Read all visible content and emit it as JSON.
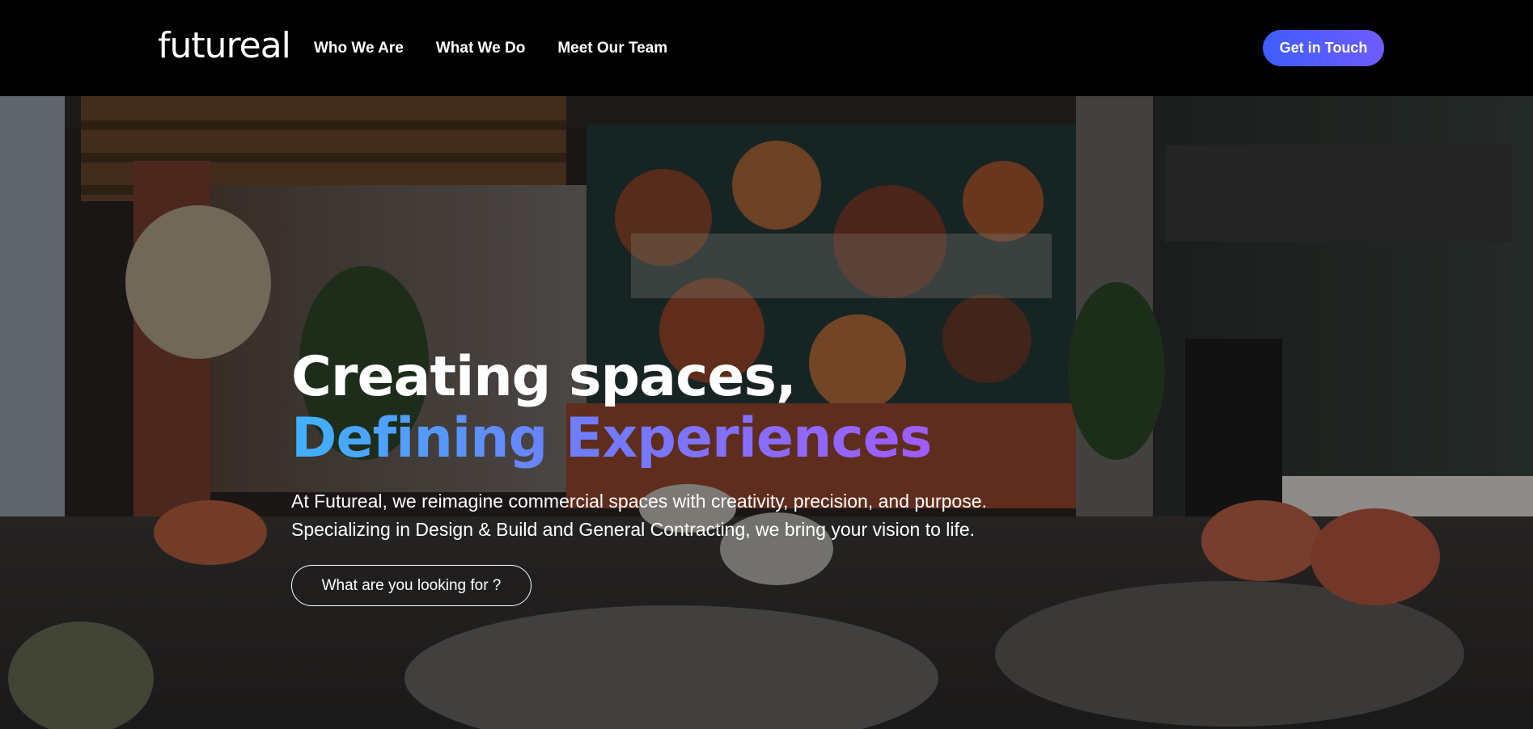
{
  "header": {
    "logo_text": "futureal",
    "nav": [
      {
        "label": "Who We Are"
      },
      {
        "label": "What We Do"
      },
      {
        "label": "Meet Our Team"
      }
    ],
    "cta_label": "Get in Touch"
  },
  "hero": {
    "headline_line1": "Creating spaces,",
    "headline_line2": "Defining Experiences",
    "subtext_line1": "At Futureal, we reimagine commercial spaces with creativity, precision, and purpose.",
    "subtext_line2": "Specializing in Design & Build and General Contracting, we bring your vision to life.",
    "button_label": "What are you looking for ?"
  },
  "colors": {
    "header_bg": "#000000",
    "cta_gradient_start": "#3d5cff",
    "cta_gradient_end": "#6f5bff",
    "headline_gradient_start": "#3fb2ff",
    "headline_gradient_end": "#a05cff"
  }
}
